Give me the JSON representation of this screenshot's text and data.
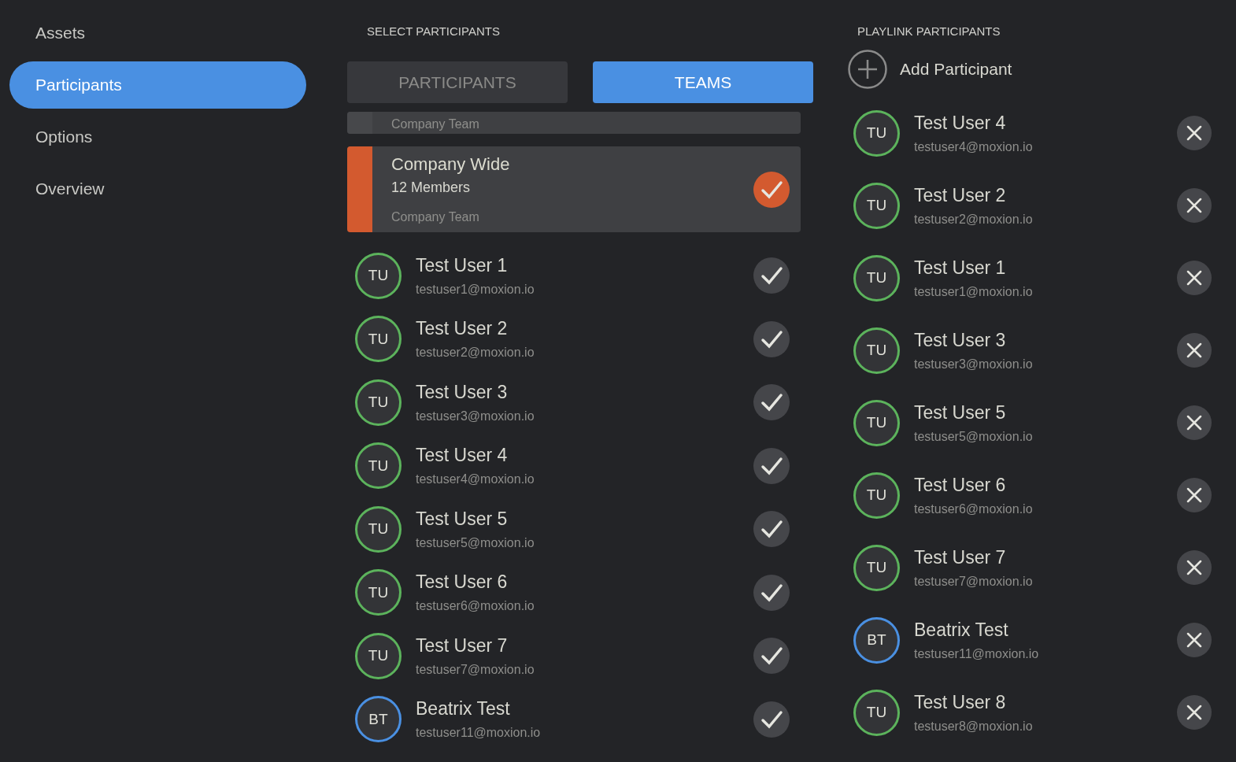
{
  "sidebar": {
    "items": [
      {
        "label": "Assets",
        "selected": false
      },
      {
        "label": "Participants",
        "selected": true
      },
      {
        "label": "Options",
        "selected": false
      },
      {
        "label": "Overview",
        "selected": false
      }
    ]
  },
  "select_participants": {
    "heading": "SELECT PARTICIPANTS",
    "tabs": [
      {
        "label": "PARTICIPANTS",
        "selected": false
      },
      {
        "label": "TEAMS",
        "selected": true
      }
    ],
    "teams": [
      {
        "kind": "partial",
        "type": "Company Team",
        "selected": false
      },
      {
        "kind": "full",
        "name": "Company Wide",
        "members": "12 Members",
        "type": "Company Team",
        "selected": true
      }
    ],
    "users": [
      {
        "initials": "TU",
        "name": "Test User 1",
        "email": "testuser1@moxion.io",
        "color": "#5cb35c",
        "selected": false
      },
      {
        "initials": "TU",
        "name": "Test User 2",
        "email": "testuser2@moxion.io",
        "color": "#5cb35c",
        "selected": false
      },
      {
        "initials": "TU",
        "name": "Test User 3",
        "email": "testuser3@moxion.io",
        "color": "#5cb35c",
        "selected": false
      },
      {
        "initials": "TU",
        "name": "Test User 4",
        "email": "testuser4@moxion.io",
        "color": "#5cb35c",
        "selected": false
      },
      {
        "initials": "TU",
        "name": "Test User 5",
        "email": "testuser5@moxion.io",
        "color": "#5cb35c",
        "selected": false
      },
      {
        "initials": "TU",
        "name": "Test User 6",
        "email": "testuser6@moxion.io",
        "color": "#5cb35c",
        "selected": false
      },
      {
        "initials": "TU",
        "name": "Test User 7",
        "email": "testuser7@moxion.io",
        "color": "#5cb35c",
        "selected": false
      },
      {
        "initials": "BT",
        "name": "Beatrix Test",
        "email": "testuser11@moxion.io",
        "color": "#4a90e2",
        "selected": false
      }
    ]
  },
  "playlink_participants": {
    "heading": "PLAYLINK PARTICIPANTS",
    "add_label": "Add Participant",
    "users": [
      {
        "initials": "TU",
        "name": "Test User 4",
        "email": "testuser4@moxion.io",
        "color": "#5cb35c"
      },
      {
        "initials": "TU",
        "name": "Test User 2",
        "email": "testuser2@moxion.io",
        "color": "#5cb35c"
      },
      {
        "initials": "TU",
        "name": "Test User 1",
        "email": "testuser1@moxion.io",
        "color": "#5cb35c"
      },
      {
        "initials": "TU",
        "name": "Test User 3",
        "email": "testuser3@moxion.io",
        "color": "#5cb35c"
      },
      {
        "initials": "TU",
        "name": "Test User 5",
        "email": "testuser5@moxion.io",
        "color": "#5cb35c"
      },
      {
        "initials": "TU",
        "name": "Test User 6",
        "email": "testuser6@moxion.io",
        "color": "#5cb35c"
      },
      {
        "initials": "TU",
        "name": "Test User 7",
        "email": "testuser7@moxion.io",
        "color": "#5cb35c"
      },
      {
        "initials": "BT",
        "name": "Beatrix Test",
        "email": "testuser11@moxion.io",
        "color": "#4a90e2"
      },
      {
        "initials": "TU",
        "name": "Test User 8",
        "email": "testuser8@moxion.io",
        "color": "#5cb35c"
      }
    ]
  }
}
